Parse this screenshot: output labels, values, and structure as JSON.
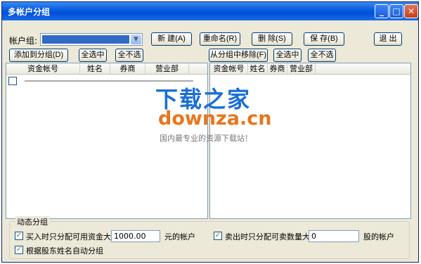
{
  "window": {
    "title": "多帐户分组"
  },
  "toolbar": {
    "account_group_label": "帐户组:",
    "combo_value": "",
    "new": "新 建(A)",
    "rename": "重命名(R)",
    "delete": "删 除(S)",
    "save": "保 存(B)",
    "exit": "退 出"
  },
  "left": {
    "add_button": "添加到分组(D)",
    "select_all": "全选中",
    "select_none": "全不选",
    "columns": [
      "资金帐号",
      "姓名",
      "券商",
      "营业部"
    ]
  },
  "right": {
    "remove_button": "从分组中移除(F)",
    "select_all": "全选中",
    "select_none": "全不选",
    "columns": [
      "资金帐号",
      "姓名",
      "券商",
      "营业部"
    ]
  },
  "dynamic": {
    "legend": "动态分组",
    "opt1_label": "买入时只分配可用资金大于",
    "opt1_value": "1000.00",
    "opt1_suffix": "元的帐户",
    "opt2_label": "卖出时只分配可卖数量大于",
    "opt2_value": "0",
    "opt2_suffix": "股的帐户",
    "opt3_label": "根据股东姓名自动分组"
  },
  "watermark": {
    "line1": "下载之家",
    "line2": "downza.cn",
    "line3": "国内最专业的资源下载站！"
  },
  "colors": {
    "title_bar": "#0a5ee0",
    "selection": "#316ac5",
    "check": "#21a121"
  }
}
